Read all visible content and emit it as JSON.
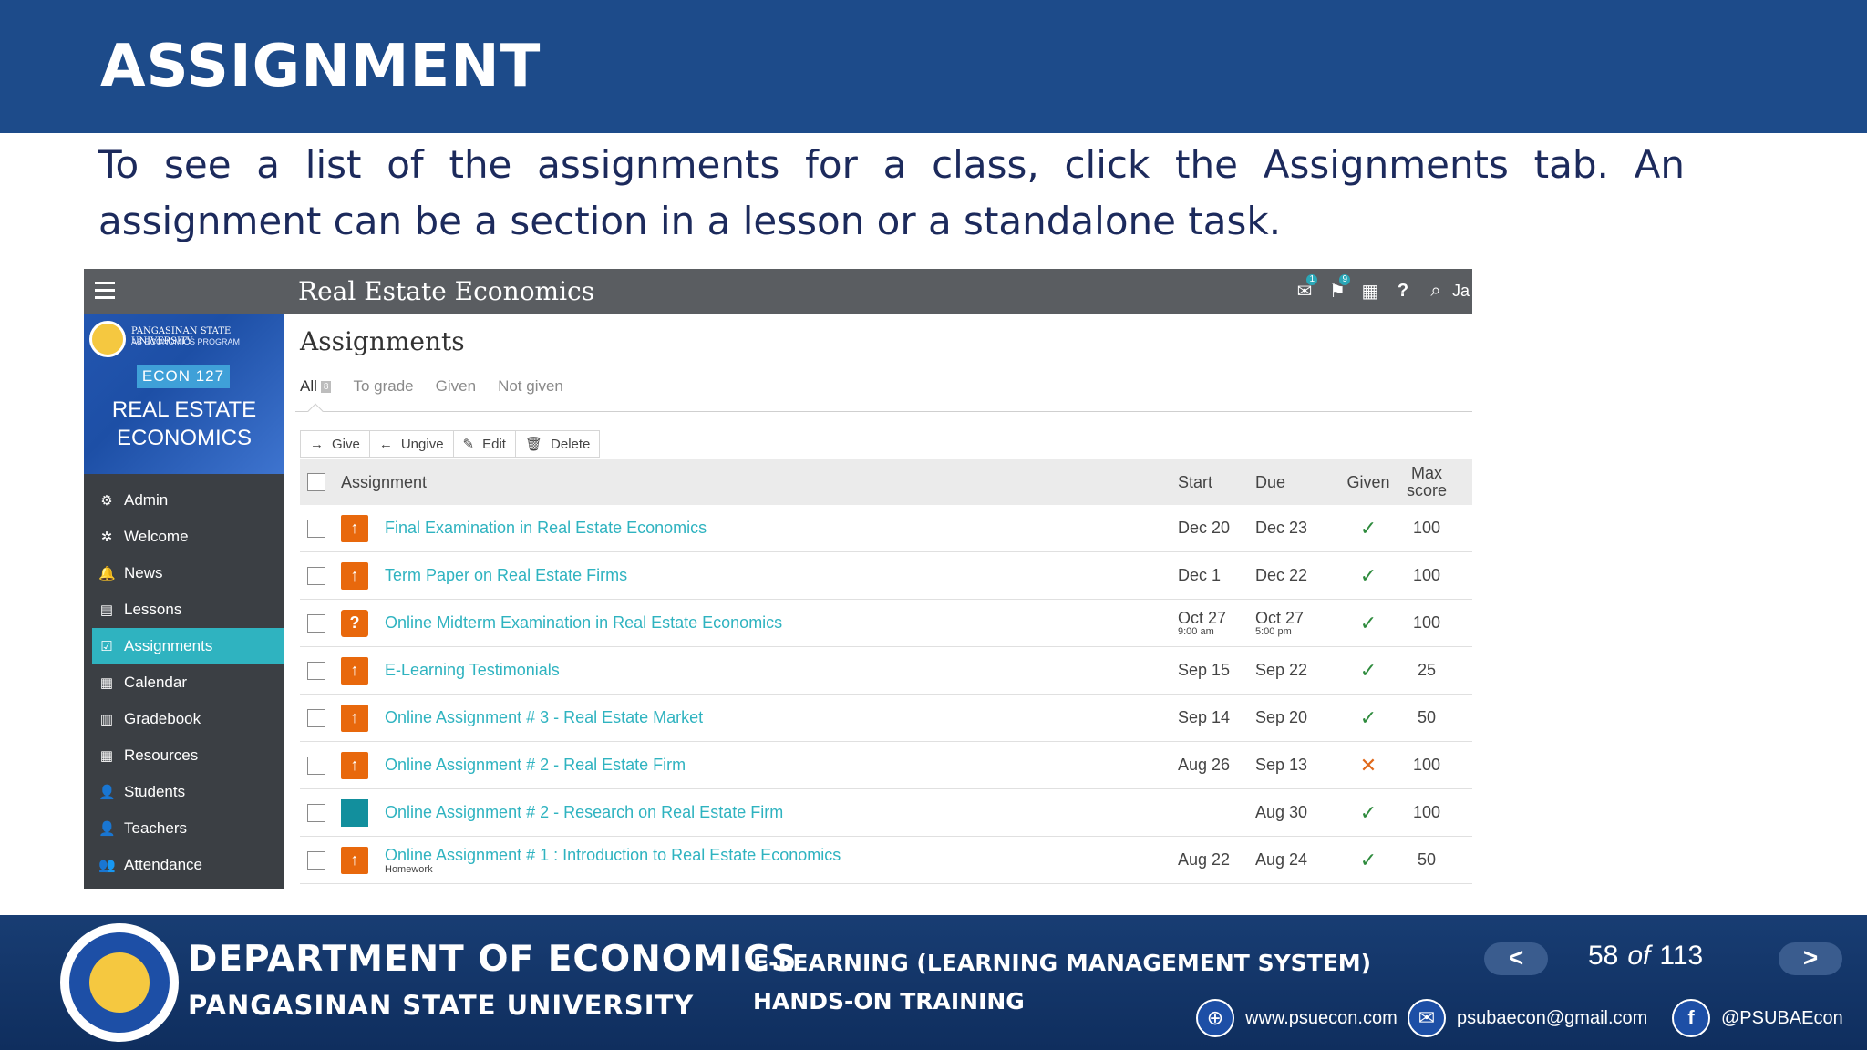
{
  "slide": {
    "title": "ASSIGNMENT",
    "description": "To see a list of the assignments for a class, click the Assignments tab. An assignment can be a section in a lesson or a standalone task."
  },
  "app": {
    "course_title": "Real Estate Economics",
    "user_initial": "Ja",
    "top_icons": [
      {
        "name": "inbox-icon",
        "badge": "1"
      },
      {
        "name": "notifications-icon",
        "badge": "9"
      },
      {
        "name": "calendar-icon",
        "badge": ""
      },
      {
        "name": "help-icon",
        "badge": ""
      },
      {
        "name": "search-icon",
        "badge": ""
      }
    ]
  },
  "banner": {
    "university": "PANGASINAN STATE UNIVERSITY",
    "program": "AB ECONOMICS PROGRAM",
    "code": "ECON 127",
    "name_line1": "REAL ESTATE",
    "name_line2": "ECONOMICS"
  },
  "sidebar": {
    "items": [
      {
        "label": "Admin",
        "icon": "gear-icon",
        "glyph": "⚙"
      },
      {
        "label": "Welcome",
        "icon": "sun-icon",
        "glyph": "✲"
      },
      {
        "label": "News",
        "icon": "bell-icon",
        "glyph": "🔔"
      },
      {
        "label": "Lessons",
        "icon": "lessons-icon",
        "glyph": "▤"
      },
      {
        "label": "Assignments",
        "icon": "checkbox-icon",
        "glyph": "☑"
      },
      {
        "label": "Calendar",
        "icon": "calendar-icon",
        "glyph": "▦"
      },
      {
        "label": "Gradebook",
        "icon": "gradebook-icon",
        "glyph": "▥"
      },
      {
        "label": "Resources",
        "icon": "resources-icon",
        "glyph": "▦"
      },
      {
        "label": "Students",
        "icon": "user-icon",
        "glyph": "👤"
      },
      {
        "label": "Teachers",
        "icon": "teacher-icon",
        "glyph": "👤"
      },
      {
        "label": "Attendance",
        "icon": "attendance-icon",
        "glyph": "👥"
      }
    ],
    "active": "Assignments"
  },
  "main": {
    "title": "Assignments",
    "tabs": [
      {
        "label": "All",
        "count": "8"
      },
      {
        "label": "To grade",
        "count": ""
      },
      {
        "label": "Given",
        "count": ""
      },
      {
        "label": "Not given",
        "count": ""
      }
    ],
    "toolbar": {
      "give": "Give",
      "ungive": "Ungive",
      "edit": "Edit",
      "delete": "Delete"
    },
    "columns": {
      "assignment": "Assignment",
      "start": "Start",
      "due": "Due",
      "given": "Given",
      "max_line1": "Max",
      "max_line2": "score"
    },
    "rows": [
      {
        "icon": "folder-upload-icon",
        "type": "folder",
        "name": "Final Examination in Real Estate Economics",
        "sub": "",
        "start": "Dec 20",
        "start_time": "",
        "due": "Dec 23",
        "due_time": "",
        "given": "✓",
        "given_status": "yes",
        "max": "100"
      },
      {
        "icon": "folder-upload-icon",
        "type": "folder",
        "name": "Term Paper on Real Estate Firms",
        "sub": "",
        "start": "Dec 1",
        "start_time": "",
        "due": "Dec 22",
        "due_time": "",
        "given": "✓",
        "given_status": "yes",
        "max": "100"
      },
      {
        "icon": "quiz-icon",
        "type": "quiz",
        "name": "Online Midterm Examination in Real Estate Economics",
        "sub": "",
        "start": "Oct 27",
        "start_time": "9:00 am",
        "due": "Oct 27",
        "due_time": "5:00 pm",
        "given": "✓",
        "given_status": "yes",
        "max": "100"
      },
      {
        "icon": "folder-upload-icon",
        "type": "folder",
        "name": "E-Learning Testimonials",
        "sub": "",
        "start": "Sep 15",
        "start_time": "",
        "due": "Sep 22",
        "due_time": "",
        "given": "✓",
        "given_status": "yes",
        "max": "25"
      },
      {
        "icon": "folder-upload-icon",
        "type": "folder",
        "name": "Online Assignment # 3 - Real Estate Market",
        "sub": "",
        "start": "Sep 14",
        "start_time": "",
        "due": "Sep 20",
        "due_time": "",
        "given": "✓",
        "given_status": "yes",
        "max": "50"
      },
      {
        "icon": "folder-upload-icon",
        "type": "folder",
        "name": "Online Assignment # 2 - Real Estate Firm",
        "sub": "",
        "start": "Aug 26",
        "start_time": "",
        "due": "Sep 13",
        "due_time": "",
        "given": "✕",
        "given_status": "no",
        "max": "100"
      },
      {
        "icon": "book-icon",
        "type": "book",
        "name": "Online Assignment # 2 - Research on Real Estate Firm",
        "sub": "",
        "start": "",
        "start_time": "",
        "due": "Aug 30",
        "due_time": "",
        "given": "✓",
        "given_status": "yes",
        "max": "100"
      },
      {
        "icon": "folder-upload-icon",
        "type": "folder",
        "name": "Online Assignment # 1 : Introduction to Real Estate Economics",
        "sub": "Homework",
        "start": "Aug 22",
        "start_time": "",
        "due": "Aug 24",
        "due_time": "",
        "given": "✓",
        "given_status": "yes",
        "max": "50"
      }
    ]
  },
  "footer": {
    "department": "DEPARTMENT OF ECONOMICS",
    "university": "PANGASINAN STATE UNIVERSITY",
    "line1": "E-LEARNING (LEARNING MANAGEMENT SYSTEM)",
    "line2": "HANDS-ON TRAINING",
    "page_current": "58",
    "page_of": "of",
    "page_total": "113",
    "website": "www.psuecon.com",
    "email": "psubaecon@gmail.com",
    "facebook": "@PSUBAEcon"
  },
  "colors": {
    "header_blue": "#1d4b8a",
    "accent_teal": "#2fb3c0",
    "assignment_orange": "#e8680c",
    "check_green": "#2e8b3d"
  }
}
